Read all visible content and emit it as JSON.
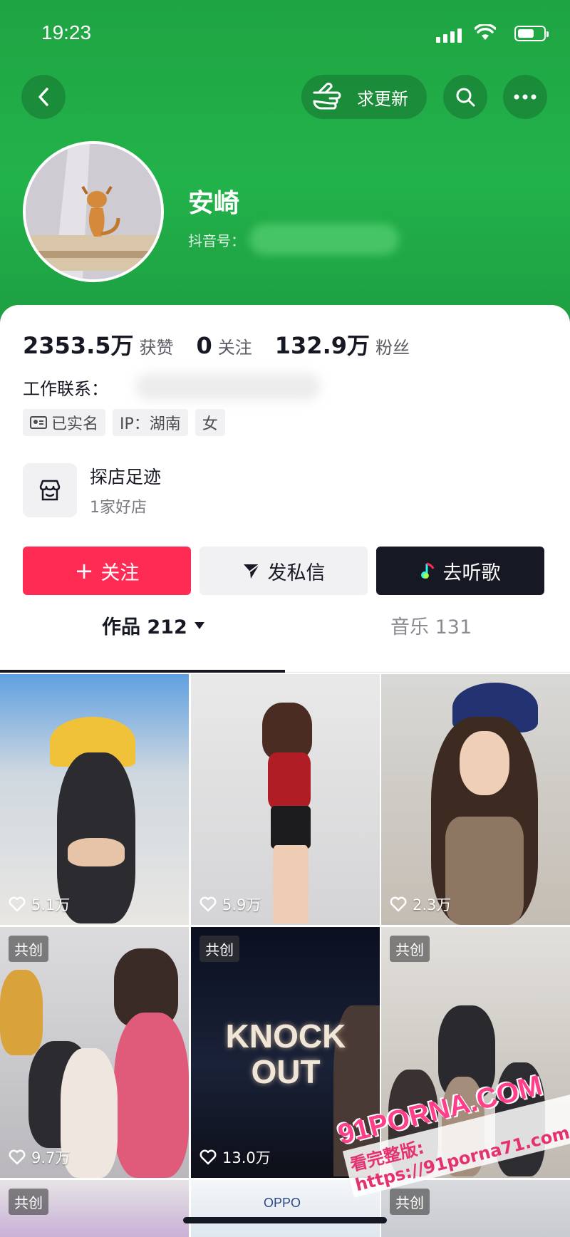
{
  "status": {
    "time": "19:23"
  },
  "header": {
    "request_update_label": "求更新",
    "name": "安崎",
    "id_label": "抖音号："
  },
  "stats": [
    {
      "value": "2353.5万",
      "label": "获赞"
    },
    {
      "value": "0",
      "label": "关注"
    },
    {
      "value": "132.9万",
      "label": "粉丝"
    }
  ],
  "contact_label": "工作联系：",
  "tags": [
    "已实名",
    "IP：湖南",
    "女"
  ],
  "store": {
    "title": "探店足迹",
    "subtitle": "1家好店"
  },
  "actions": {
    "follow": "关注",
    "message": "发私信",
    "music": "去听歌"
  },
  "tabs": {
    "works": "作品 212",
    "music": "音乐 131"
  },
  "videos": [
    {
      "likes": "5.1万",
      "badge": ""
    },
    {
      "likes": "5.9万",
      "badge": ""
    },
    {
      "likes": "2.3万",
      "badge": ""
    },
    {
      "likes": "9.7万",
      "badge": "共创"
    },
    {
      "likes": "13.0万",
      "badge": "共创",
      "poster_title": "KNOCK OUT"
    },
    {
      "likes": "",
      "badge": "共创"
    },
    {
      "likes": "",
      "badge": "共创"
    },
    {
      "likes": "",
      "badge": "",
      "poster_title": "OPPO"
    },
    {
      "likes": "",
      "badge": "共创"
    }
  ],
  "watermark": {
    "line1": "91PORNA.COM",
    "line2": "看完整版: https://91porna71.com"
  },
  "colors": {
    "header_green": "#22b24a",
    "follow_red": "#fe2c55",
    "dark": "#161823"
  }
}
